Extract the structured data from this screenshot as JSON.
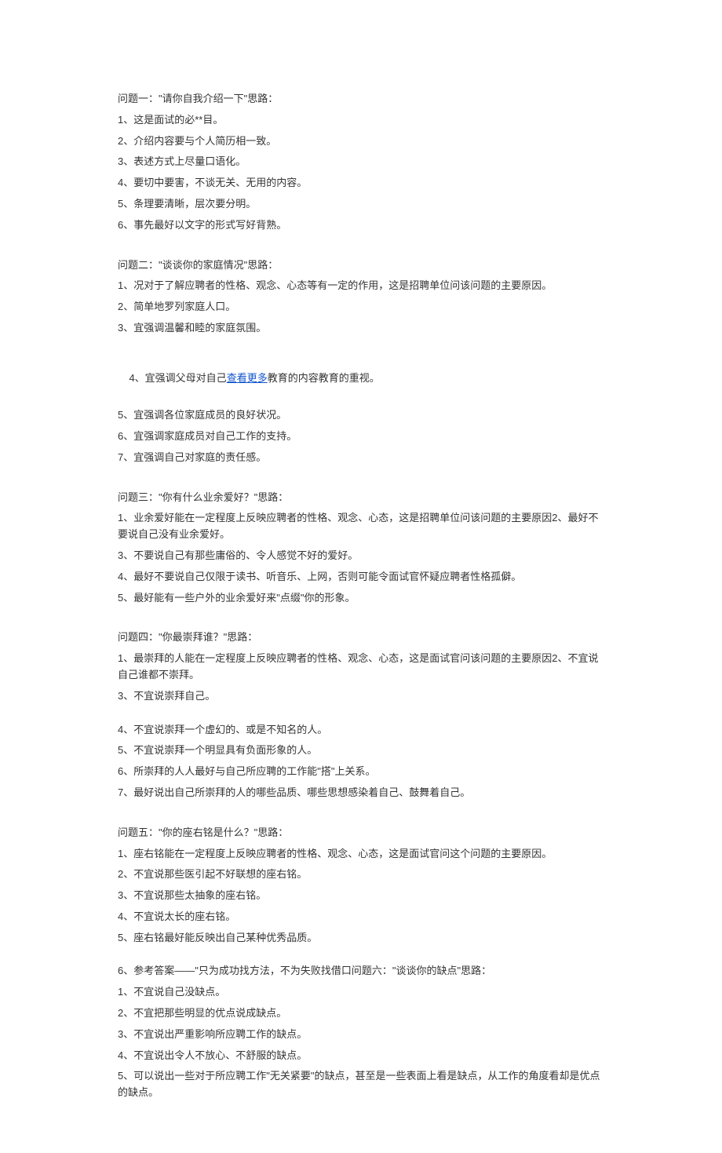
{
  "q1": {
    "title": "问题一：\"请你自我介绍一下\"思路：",
    "items": [
      "1、这是面试的必**目。",
      "2、介绍内容要与个人简历相一致。",
      "3、表述方式上尽量口语化。",
      "4、要切中要害，不谈无关、无用的内容。",
      "5、条理要清晰，层次要分明。",
      "6、事先最好以文字的形式写好背熟。"
    ]
  },
  "q2": {
    "title": "问题二：\"谈谈你的家庭情况\"思路：",
    "items": [
      "1、况对于了解应聘者的性格、观念、心态等有一定的作用，这是招聘单位问该问题的主要原因。",
      "2、简单地罗列家庭人口。",
      "3、宜强调温馨和睦的家庭氛围。"
    ],
    "link": {
      "pre": "4、宜强调父母对自己",
      "link_text": "查看更多",
      "post": "教育的内容教育的重视。"
    },
    "items2": [
      "5、宜强调各位家庭成员的良好状况。",
      "6、宜强调家庭成员对自己工作的支持。",
      "7、宜强调自己对家庭的责任感。"
    ]
  },
  "q3": {
    "title": "问题三：\"你有什么业余爱好？\"思路：",
    "items": [
      "1、业余爱好能在一定程度上反映应聘者的性格、观念、心态，这是招聘单位问该问题的主要原因2、最好不要说自己没有业余爱好。",
      "3、不要说自己有那些庸俗的、令人感觉不好的爱好。",
      "4、最好不要说自己仅限于读书、听音乐、上网，否则可能令面试官怀疑应聘者性格孤僻。",
      "5、最好能有一些户外的业余爱好来\"点缀\"你的形象。"
    ]
  },
  "q4": {
    "title": "问题四：\"你最崇拜谁？\"思路：",
    "first": "1、最崇拜的人能在一定程度上反映应聘者的性格、观念、心态，这是面试官问该问题的主要原因2、不宜说自己谁都不崇拜。",
    "items": [
      "3、不宜说崇拜自己。",
      "4、不宜说崇拜一个虚幻的、或是不知名的人。",
      "5、不宜说崇拜一个明显具有负面形象的人。",
      "6、所崇拜的人人最好与自己所应聘的工作能\"搭\"上关系。",
      "7、最好说出自己所崇拜的人的哪些品质、哪些思想感染着自己、鼓舞着自己。"
    ]
  },
  "q5": {
    "title": "问题五：\"你的座右铭是什么？\"思路：",
    "items": [
      "1、座右铭能在一定程度上反映应聘者的性格、观念、心态，这是面试官问这个问题的主要原因。",
      "2、不宜说那些医引起不好联想的座右铭。",
      "3、不宜说那些太抽象的座右铭。",
      "4、不宜说太长的座右铭。",
      "5、座右铭最好能反映出自己某种优秀品质。"
    ]
  },
  "q6": {
    "first": "6、参考答案——\"只为成功找方法，不为失败找借口问题六：\"谈谈你的缺点\"思路：",
    "items": [
      "1、不宜说自己没缺点。",
      "2、不宜把那些明显的优点说成缺点。",
      "3、不宜说出严重影响所应聘工作的缺点。",
      "4、不宜说出令人不放心、不舒服的缺点。",
      "5、可以说出一些对于所应聘工作\"无关紧要\"的缺点，甚至是一些表面上看是缺点，从工作的角度看却是优点的缺点。"
    ]
  }
}
